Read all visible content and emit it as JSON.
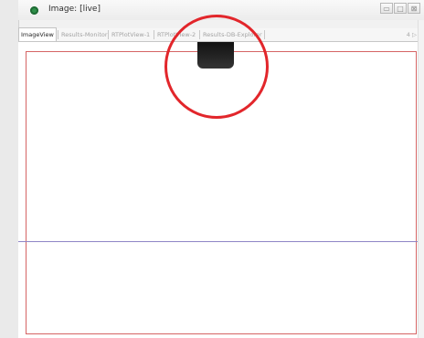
{
  "window": {
    "title": "Image: [live]",
    "controls": [
      "▭",
      "□",
      "⊠"
    ],
    "icon": "green-eye-icon"
  },
  "tabs": [
    {
      "label": "ImageView",
      "active": true
    },
    {
      "label": "Results-Monitor",
      "active": false
    },
    {
      "label": "RTPlotView-1",
      "active": false
    },
    {
      "label": "RTPlotView-2",
      "active": false
    },
    {
      "label": "Results-DB-Explorer",
      "active": false
    }
  ],
  "tab_nav": "4 ▷",
  "colors": {
    "roi": "#d56464",
    "crosshair": "#8f85c6",
    "highlight": "#e2262b",
    "icon": "#2e8f49"
  }
}
